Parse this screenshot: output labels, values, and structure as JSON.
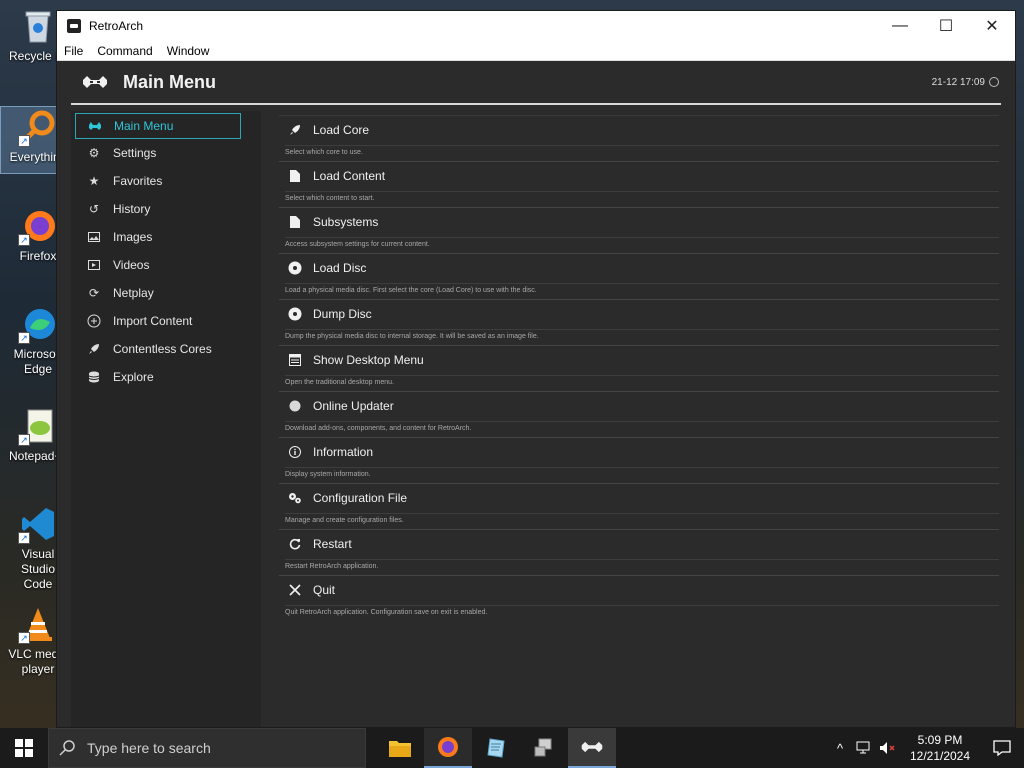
{
  "desktop": {
    "icons": [
      {
        "label": "Recycle Bin",
        "icon": "recycle-bin-icon"
      },
      {
        "label": "Everything",
        "icon": "everything-search-icon"
      },
      {
        "label": "Firefox",
        "icon": "firefox-icon"
      },
      {
        "label": "Microsoft Edge",
        "icon": "edge-icon"
      },
      {
        "label": "Notepad++",
        "icon": "notepadpp-icon"
      },
      {
        "label": "Visual Studio Code",
        "icon": "vscode-icon"
      },
      {
        "label": "VLC media player",
        "icon": "vlc-icon"
      }
    ]
  },
  "window": {
    "title": "RetroArch",
    "controls": {
      "minimize": "—",
      "maximize": "☐",
      "close": "✕"
    },
    "menus": [
      "File",
      "Command",
      "Window"
    ]
  },
  "retroarch": {
    "header_title": "Main Menu",
    "clock": "21-12 17:09",
    "accent": "#2ec6d8",
    "sidebar": [
      {
        "label": "Main Menu",
        "icon": "invader-icon"
      },
      {
        "label": "Settings",
        "icon": "gear-icon"
      },
      {
        "label": "Favorites",
        "icon": "star-icon"
      },
      {
        "label": "History",
        "icon": "history-icon"
      },
      {
        "label": "Images",
        "icon": "image-icon"
      },
      {
        "label": "Videos",
        "icon": "video-icon"
      },
      {
        "label": "Netplay",
        "icon": "netplay-icon"
      },
      {
        "label": "Import Content",
        "icon": "plus-icon"
      },
      {
        "label": "Contentless Cores",
        "icon": "rocket-icon"
      },
      {
        "label": "Explore",
        "icon": "database-icon"
      }
    ],
    "entries": [
      {
        "label": "Load Core",
        "sub": "Select which core to use.",
        "icon": "rocket-icon"
      },
      {
        "label": "Load Content",
        "sub": "Select which content to start.",
        "icon": "file-icon"
      },
      {
        "label": "Subsystems",
        "sub": "Access subsystem settings for current content.",
        "icon": "file-icon"
      },
      {
        "label": "Load Disc",
        "sub": "Load a physical media disc. First select the core (Load Core) to use with the disc.",
        "icon": "disc-icon"
      },
      {
        "label": "Dump Disc",
        "sub": "Dump the physical media disc to internal storage. It will be saved as an image file.",
        "icon": "disc-icon"
      },
      {
        "label": "Show Desktop Menu",
        "sub": "Open the traditional desktop menu.",
        "icon": "desktop-menu-icon"
      },
      {
        "label": "Online Updater",
        "sub": "Download add-ons, components, and content for RetroArch.",
        "icon": "globe-icon"
      },
      {
        "label": "Information",
        "sub": "Display system information.",
        "icon": "info-icon"
      },
      {
        "label": "Configuration File",
        "sub": "Manage and create configuration files.",
        "icon": "config-icon"
      },
      {
        "label": "Restart",
        "sub": "Restart RetroArch application.",
        "icon": "restart-icon"
      },
      {
        "label": "Quit",
        "sub": "Quit RetroArch application. Configuration save on exit is enabled.",
        "icon": "close-icon"
      }
    ]
  },
  "taskbar": {
    "search_placeholder": "Type here to search",
    "time": "5:09 PM",
    "date": "12/21/2024",
    "apps": [
      "file-explorer-icon",
      "firefox-icon",
      "notepad-icon",
      "network-app-icon",
      "retroarch-icon"
    ]
  }
}
